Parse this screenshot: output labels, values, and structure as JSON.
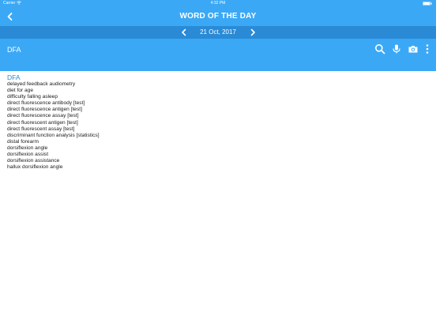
{
  "status_bar": {
    "carrier": "Carrier",
    "time": "4:32 PM"
  },
  "header": {
    "title": "WORD OF THE DAY"
  },
  "date_nav": {
    "date": "21 Oct, 2017"
  },
  "search": {
    "query": "DFA"
  },
  "results": {
    "heading": "DFA",
    "items": [
      "delayed feedback audiometry",
      "diet for age",
      "difficulty falling asleep",
      "direct fluorescence antibody [test]",
      "direct fluorescence antigen [test]",
      "direct fluorescence assay [test]",
      "direct fluorescent antigen [test]",
      "direct fluorescent assay [test]",
      "discriminant function analysis [statistics]",
      "distal forearm",
      "dorsiflexion angle",
      "dorsiflexion assist",
      "dorsiflexion assistance",
      "hallux dorsiflexion angle"
    ]
  },
  "icons": {
    "back": "chevron-left-icon",
    "prev": "chevron-left-icon",
    "next": "chevron-right-icon",
    "search": "search-icon",
    "mic": "microphone-icon",
    "camera": "camera-icon",
    "more": "more-vertical-icon",
    "wifi": "wifi-icon",
    "battery": "battery-icon"
  },
  "colors": {
    "primary": "#3ba8f5",
    "primary_dark": "#2a8ad6",
    "heading": "#2a8ad6"
  }
}
